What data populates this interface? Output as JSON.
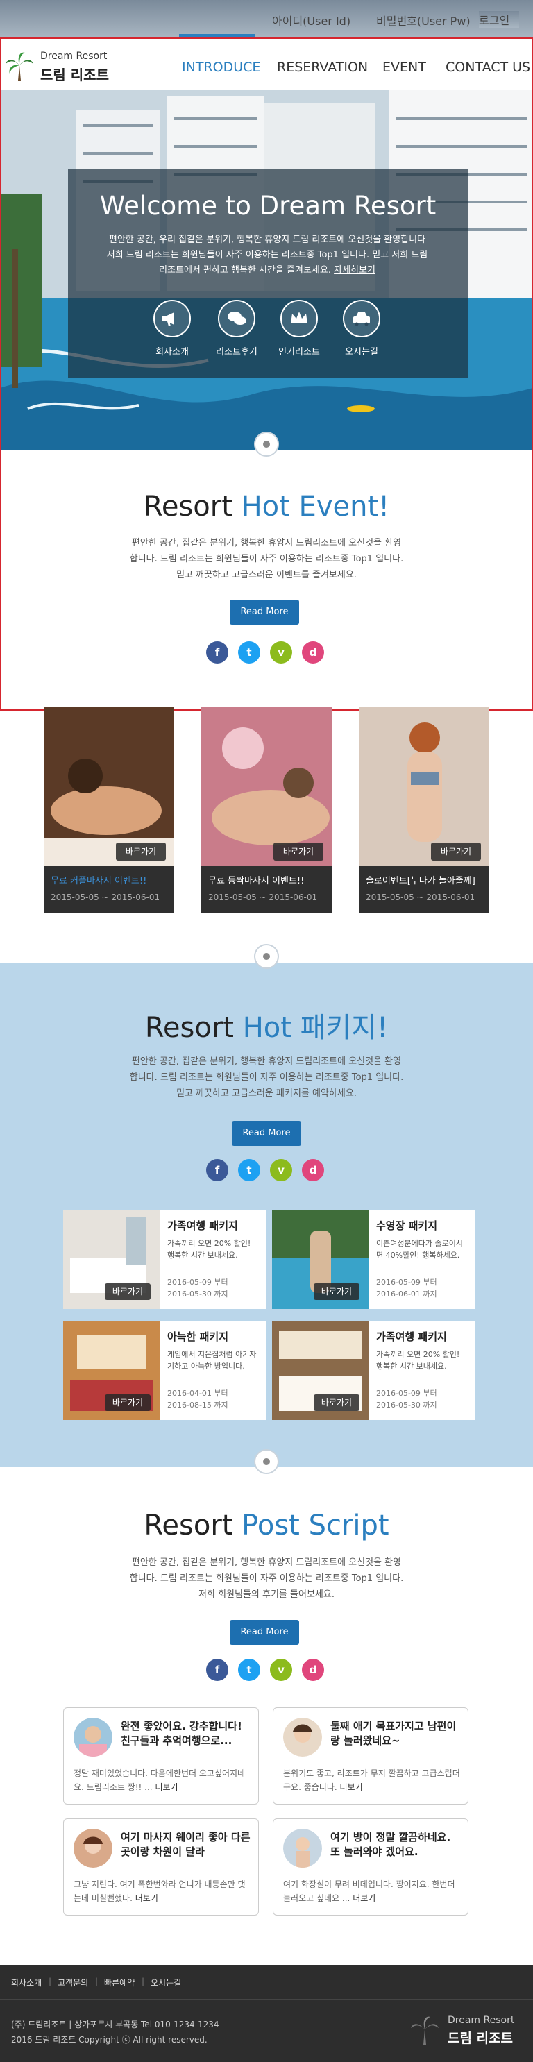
{
  "topbar": {
    "user_id": "아이디(User Id)",
    "user_pw": "비밀번호(User Pw)",
    "login": "로그인"
  },
  "logo": {
    "en": "Dream Resort",
    "ko": "드림 리조트"
  },
  "nav": [
    "INTRODUCE",
    "RESERVATION",
    "EVENT",
    "CONTACT US"
  ],
  "hero": {
    "title": "Welcome to Dream Resort",
    "text": "편안한 공간, 우리 집같은 분위기, 행복한 휴양지 드림 리조트에 오신것을 환영합니다 저희 드림 리조트는 회원님들이 자주 이용하는 리조트중 Top1 입니다. 믿고 저희 드림 리조트에서 편하고 행복한 시간을 즐겨보세요.",
    "more": "자세히보기",
    "icons": [
      {
        "label": "회사소개",
        "icon": "megaphone-icon"
      },
      {
        "label": "리조트후기",
        "icon": "chat-icon"
      },
      {
        "label": "인기리조트",
        "icon": "crown-icon"
      },
      {
        "label": "오시는길",
        "icon": "car-icon"
      }
    ]
  },
  "event": {
    "title_a": "Resort ",
    "title_b": "Hot Event!",
    "text": "편안한 공간, 집같은 분위기, 행복한 휴양지 드림리조트에 오신것을 환영합니다. 드림 리조트는 회원님들이 자주 이용하는 리조트중 Top1 입니다. 믿고 깨끗하고 고급스러운 이벤트를 즐겨보세요.",
    "read_more": "Read More",
    "cards": [
      {
        "title": "무료 커플마사지 이벤트!!",
        "date": "2015-05-05 ~ 2015-06-01",
        "btn": "바로가기",
        "title_color": "#3b8fd6"
      },
      {
        "title": "무료 등짝마사지 이벤트!!",
        "date": "2015-05-05 ~ 2015-06-01",
        "btn": "바로가기",
        "title_color": "#ffffff"
      },
      {
        "title": "솔로이벤트[누나가 놀아줄께]",
        "date": "2015-05-05 ~ 2015-06-01",
        "btn": "바로가기",
        "title_color": "#ffffff"
      }
    ]
  },
  "packages": {
    "title_a": "Resort ",
    "title_b": "Hot 패키지!",
    "text": "편안한 공간, 집같은 분위기, 행복한 휴양지 드림리조트에 오신것을 환영합니다. 드림 리조트는 회원님들이 자주 이용하는 리조트중 Top1 입니다. 믿고 깨끗하고 고급스러운 패키지를 예약하세요.",
    "read_more": "Read More",
    "items": [
      {
        "title": "가족여행 패키지",
        "desc": "가족끼리 오면 20% 할인! 행복한 시간 보내세요.",
        "date1": "2016-05-09 부터",
        "date2": "2016-05-30 까지",
        "btn": "바로가기"
      },
      {
        "title": "수영장 패키지",
        "desc": "이쁜여성분에다가 솔로이시면 40%할인! 행복하세요.",
        "date1": "2016-05-09 부터",
        "date2": "2016-06-01 까지",
        "btn": "바로가기"
      },
      {
        "title": "아늑한 패키지",
        "desc": "게임에서 지은집처럼 아기자기하고 아늑한 방입니다.",
        "date1": "2016-04-01 부터",
        "date2": "2016-08-15 까지",
        "btn": "바로가기"
      },
      {
        "title": "가족여행 패키지",
        "desc": "가족끼리 오면 20% 할인! 행복한 시간 보내세요.",
        "date1": "2016-05-09 부터",
        "date2": "2016-05-30 까지",
        "btn": "바로가기"
      }
    ]
  },
  "postscript": {
    "title_a": "Resort ",
    "title_b": "Post Script",
    "text": "편안한 공간, 집같은 분위기, 행복한 휴양지 드림리조트에 오신것을 환영합니다. 드림 리조트는 회원님들이 자주 이용하는 리조트중 Top1 입니다. 저희 회원님들의 후기를 들어보세요.",
    "read_more": "Read More",
    "reviews": [
      {
        "title": "완전 좋았어요. 강추합니다! 친구들과 추억여행으로...",
        "body": "정말 재미있었습니다. 다음에한번더 오고싶어지네요. 드림리조트 짱!! ...",
        "more": "더보기"
      },
      {
        "title": "둘째 애기 목표가지고 남편이랑 놀러왔네요~",
        "body": "분위기도 좋고, 리조트가 무지 깔끔하고 고급스럽더구요. 좋습니다.",
        "more": "더보기"
      },
      {
        "title": "여기 마사지 웨이리 좋아 다른곳이랑 차원이 달라",
        "body": "그냥 지린다. 여기 폭한번와라 언니가 내등손만 댓는데 미칠뻔했다.",
        "more": "더보기"
      },
      {
        "title": "여기 방이 정말 깔끔하네요. 또 놀러와야 겠어요.",
        "body": "여기 화장실이 무려 비데입니다. 짱이지요. 한번더 놀러오고 싶네요 ...",
        "more": "더보기"
      }
    ]
  },
  "social": [
    "f",
    "t",
    "v",
    "d"
  ],
  "social_colors": [
    "#3b5998",
    "#1da1f2",
    "#8cbb1d",
    "#e0467c"
  ],
  "footer": {
    "links": [
      "회사소개",
      "고객문의",
      "빠른예약",
      "오시는길"
    ],
    "info1": "(주) 드림리조트 | 상가포르시 부곡동 Tel 010-1234-1234",
    "info2": "2016 드림 리조트 Copyright ⓒ All right reserved.",
    "logo_en": "Dream Resort",
    "logo_ko": "드림 리조트"
  }
}
